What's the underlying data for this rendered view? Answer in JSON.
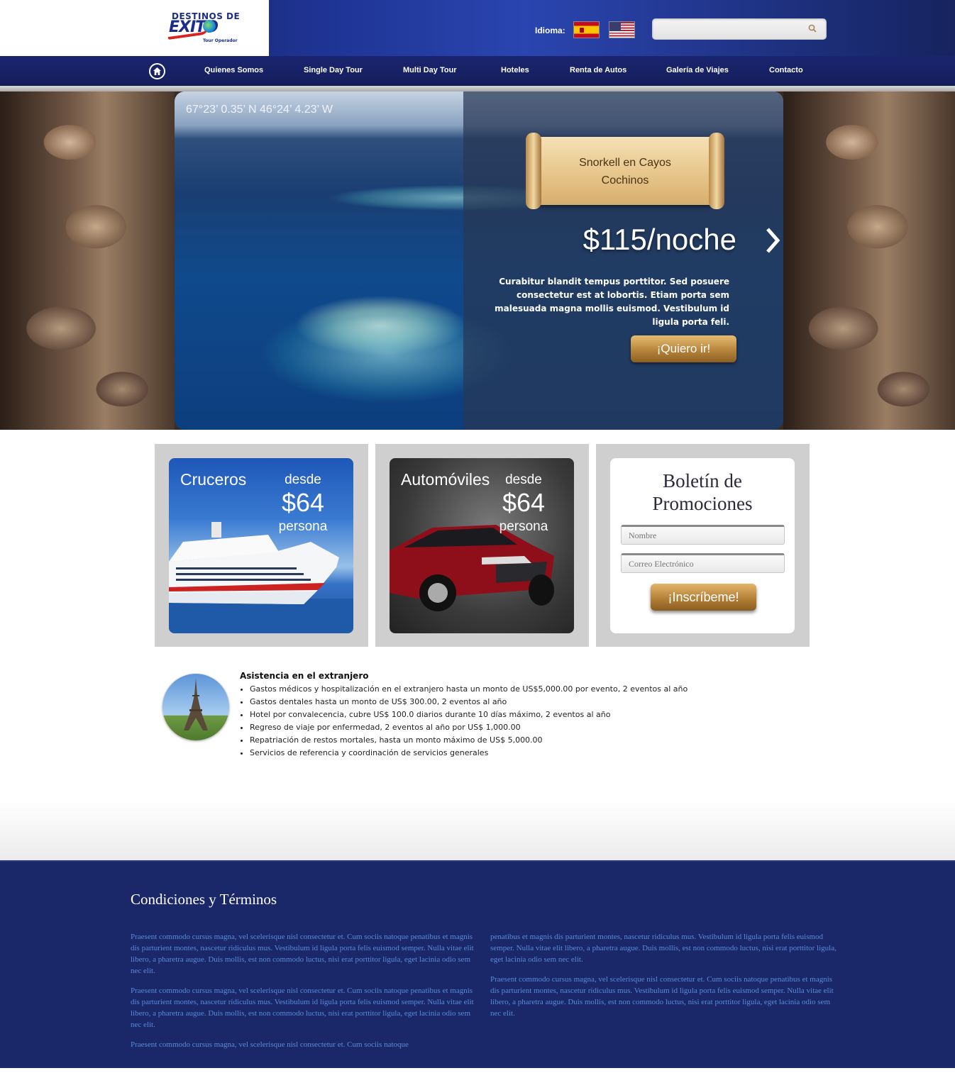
{
  "header": {
    "logo": {
      "line1": "DESTINOS DE",
      "line2": "EXITO",
      "line3": "Tour Operador"
    },
    "language_label": "Idioma:",
    "flags": [
      "spain-flag",
      "usa-flag"
    ],
    "search": {
      "placeholder": "",
      "value": ""
    }
  },
  "nav": {
    "items": [
      "Quienes Somos",
      "Single Day Tour",
      "Multi Day Tour",
      "Hoteles",
      "Renta de Autos",
      "Galería de Viajes",
      "Contacto"
    ]
  },
  "hero": {
    "coords": "67°23’ 0.35’ N 46°24’ 4.23’ W",
    "scroll_line1": "Snorkell en Cayos",
    "scroll_line2": "Cochinos",
    "price": "$115/noche",
    "description": "Curabitur blandit tempus porttitor. Sed posuere consectetur est at lobortis. Etiam porta sem malesuada magna mollis euismod. Vestibulum id ligula porta feli.",
    "button": "¡Quiero ir!"
  },
  "cards": {
    "cruceros": {
      "title": "Cruceros",
      "desde": "desde",
      "amount": "$64",
      "persona": "persona"
    },
    "autos": {
      "title": "Automóviles",
      "desde": "desde",
      "amount": "$64",
      "persona": "persona"
    },
    "promo": {
      "title_line1": "Boletín de",
      "title_line2": "Promociones",
      "name_placeholder": "Nombre",
      "email_placeholder": "Correo Electrónico",
      "button": "¡Inscríbeme!"
    }
  },
  "assistance": {
    "title": "Asistencia en el extranjero",
    "items": [
      "Gastos médicos y hospitalización en el extranjero hasta un monto de US$5,000.00 por evento, 2 eventos al año",
      "Gastos dentales hasta un monto de US$ 300.00, 2 eventos al año",
      "Hotel por convalecencia, cubre US$ 100.0 diarios durante 10 días máximo, 2 eventos al año",
      "Regreso de viaje por enfermedad, 2 eventos al año por US$ 1,000.00",
      "Repatriación de restos mortales, hasta un monto máximo de US$ 5,000.00",
      "Servicios de referencia y coordinación de servicios generales"
    ]
  },
  "footer": {
    "title": "Condiciones y Términos",
    "left": [
      "Praesent commodo cursus magna, vel scelerisque nisl consectetur et. Cum sociis natoque penatibus et magnis dis parturient montes, nascetur ridiculus mus. Vestibulum id ligula porta felis euismod semper. Nulla vitae elit libero, a pharetra augue. Duis mollis, est non commodo luctus, nisi erat porttitor ligula, eget lacinia odio sem nec elit.",
      "Praesent commodo cursus magna, vel scelerisque nisl consectetur et. Cum sociis natoque penatibus et magnis dis parturient montes, nascetur ridiculus mus. Vestibulum id ligula porta felis euismod semper. Nulla vitae elit libero, a pharetra augue. Duis mollis, est non commodo luctus, nisi erat porttitor ligula, eget lacinia odio sem nec elit.",
      "Praesent commodo cursus magna, vel scelerisque nisl consectetur et. Cum sociis natoque"
    ],
    "right": [
      "penatibus et magnis dis parturient montes, nascetur ridiculus mus. Vestibulum id ligula porta felis euismod semper. Nulla vitae elit libero, a pharetra augue. Duis mollis, est non commodo luctus, nisi erat porttitor ligula, eget lacinia odio sem nec elit.",
      "Praesent commodo cursus magna, vel scelerisque nisl consectetur et. Cum sociis natoque penatibus et magnis dis parturient montes, nascetur ridiculus mus. Vestibulum id ligula porta felis euismod semper. Nulla vitae elit libero, a pharetra augue. Duis mollis, est non commodo luctus, nisi erat porttitor ligula, eget lacinia odio sem nec elit."
    ]
  },
  "colors": {
    "header_blue": "#1f3595",
    "nav_blue": "#1a2570",
    "footer_blue": "#1a2768",
    "gold_button": "#b7843c",
    "footer_text": "#5b8bd8"
  }
}
